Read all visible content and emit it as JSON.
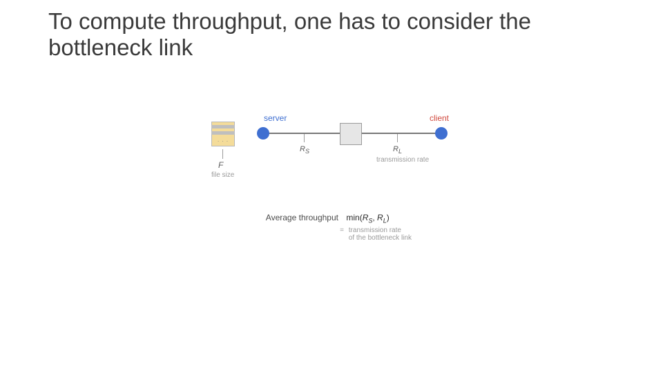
{
  "title": "To compute throughput, one has to consider the bottleneck link",
  "labels": {
    "server": "server",
    "client": "client",
    "F": "F",
    "file_size": "file size",
    "Rs_main": "R",
    "Rs_sub": "S",
    "Rl_main": "R",
    "Rl_sub": "L",
    "tx_rate": "transmission rate"
  },
  "formula": {
    "lhs": "Average throughput",
    "min_fn": "min",
    "arg1_main": "R",
    "arg1_sub": "S",
    "sep": ", ",
    "arg2_main": "R",
    "arg2_sub": "L",
    "close": ")",
    "open": "(",
    "eq": "=",
    "explain_l1": "transmission rate",
    "explain_l2": "of the bottleneck link"
  },
  "colors": {
    "server": "#3f6fd1",
    "client": "#3f6fd1",
    "labelServer": "#3f6fd1",
    "labelClient": "#d14a3f"
  }
}
